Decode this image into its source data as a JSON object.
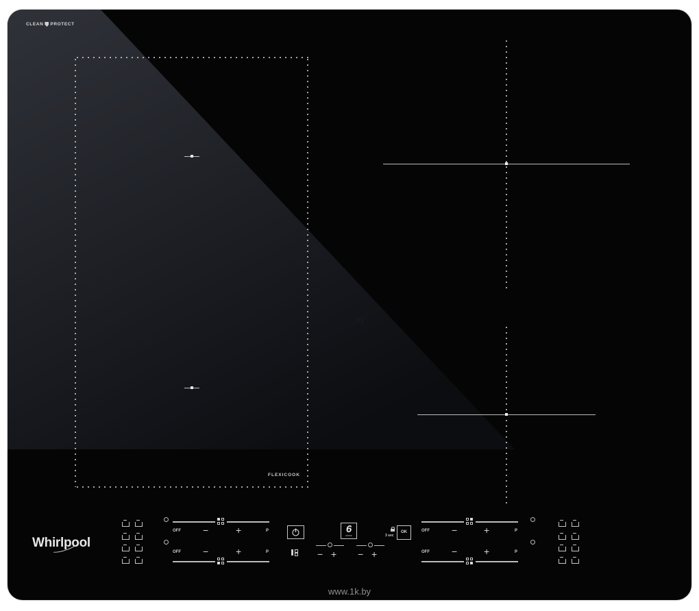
{
  "product": {
    "brand_logo": "Whirlpool",
    "top_badge": "CLEAN PROTECT",
    "top_badge_icon": "shield-icon",
    "flexi_zone_label": "FLEXICOOK"
  },
  "colors": {
    "glass": "#050505",
    "reflection": "#2a2d33",
    "markings": "#d0d0d0",
    "page_background": "#ffffff"
  },
  "controls": {
    "left_zones": [
      {
        "off_label": "OFF",
        "minus": "−",
        "plus": "+",
        "boost": "P",
        "indicator": "top-left-active"
      },
      {
        "off_label": "OFF",
        "minus": "−",
        "plus": "+",
        "boost": "P",
        "indicator": "bottom-left-active"
      }
    ],
    "right_zones": [
      {
        "off_label": "OFF",
        "minus": "−",
        "plus": "+",
        "boost": "P",
        "indicator": "top-right-active"
      },
      {
        "off_label": "OFF",
        "minus": "−",
        "plus": "+",
        "boost": "P",
        "indicator": "bottom-right-active"
      }
    ],
    "power_button_icon": "power-icon",
    "sense_button_label": "6",
    "sense_button_sublabel": "sense",
    "timer_controls": [
      {
        "minus": "−",
        "plus": "+"
      },
      {
        "minus": "−",
        "plus": "+"
      }
    ],
    "lock_label": "3 sec",
    "ok_label": "OK",
    "layout_icon": "zone-layout-icon",
    "preset_icons": [
      "pot-icon",
      "pan-icon",
      "pot-steam-icon",
      "pan-steam-icon",
      "pot-icon",
      "pan-icon",
      "pot-steam-icon",
      "pan-steam-icon"
    ]
  },
  "watermark": "www.1k.by",
  "faint_watermark": ".by"
}
